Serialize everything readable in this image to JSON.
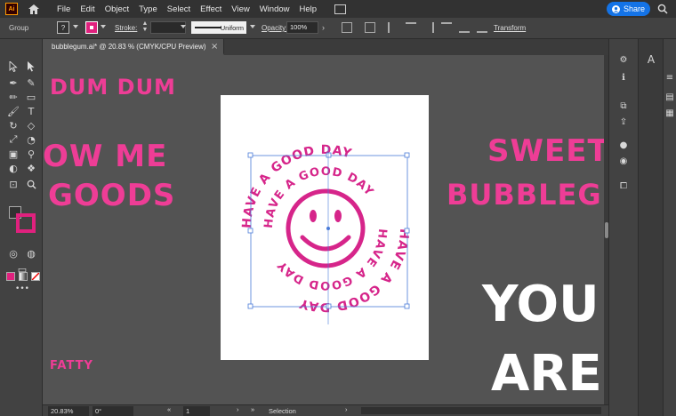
{
  "app": {
    "logo_text": "Ai",
    "share_label": "Share"
  },
  "menu": [
    "File",
    "Edit",
    "Object",
    "Type",
    "Select",
    "Effect",
    "View",
    "Window",
    "Help"
  ],
  "control": {
    "selection_type": "Group",
    "fill_none_symbol": "?",
    "stroke_label": "Stroke:",
    "stroke_style": "Uniform",
    "opacity_label": "Opacity:",
    "opacity_value": "100%",
    "transform_label": "Transform"
  },
  "document": {
    "tab_title": "bubblegum.ai* @ 20.83 % (CMYK/CPU Preview)",
    "close_symbol": "×"
  },
  "canvas_text": {
    "dum": "DUM DUM",
    "ow_me": "OW ME",
    "goods": "GOODS",
    "sweet": "SWEET,",
    "bubblegum": "BUBBLEGUM",
    "you": "YOU",
    "are": "ARE",
    "fatty": "FATTY",
    "spiral": "HAVE A GOOD DAY"
  },
  "status": {
    "zoom": "20.83%",
    "rotation": "0°",
    "artboard_no": "1",
    "current_tool": "Selection"
  },
  "colors": {
    "accent_pink": "#ee3d96",
    "artwork_magenta": "#d6258a",
    "selection_blue": "#4a7bd8",
    "share_blue": "#1473e6"
  }
}
